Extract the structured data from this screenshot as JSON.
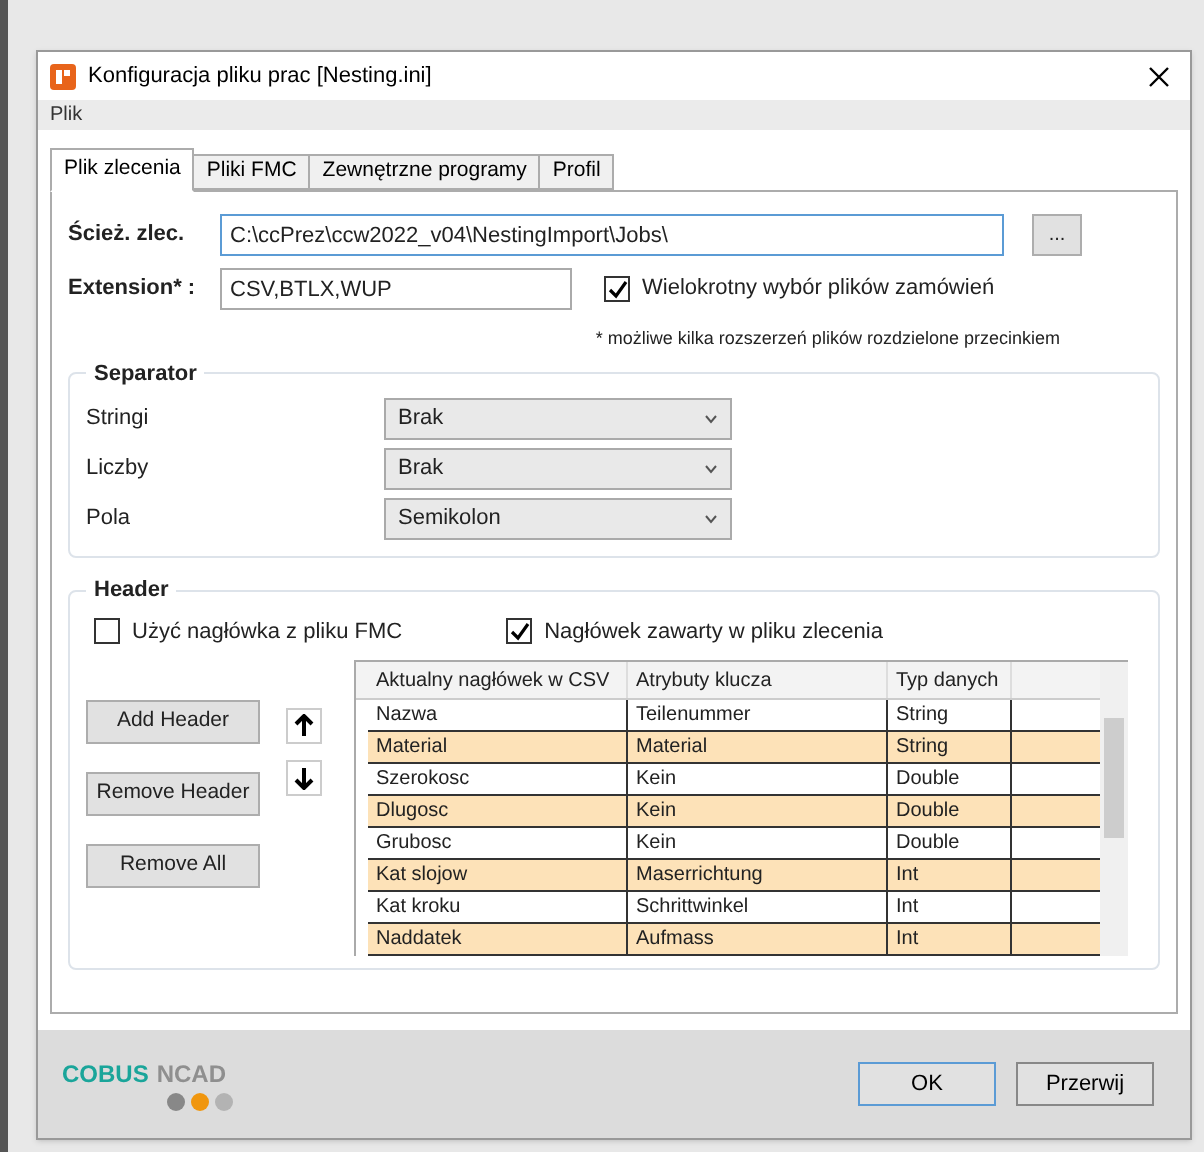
{
  "window": {
    "title": "Konfiguracja pliku prac [Nesting.ini]"
  },
  "menu": [
    "Plik"
  ],
  "tabs": [
    {
      "label": "Plik zlecenia",
      "selected": true
    },
    {
      "label": "Pliki FMC",
      "selected": false
    },
    {
      "label": "Zewnętrzne programy",
      "selected": false
    },
    {
      "label": "Profil",
      "selected": false
    }
  ],
  "path": {
    "label": "Ścież. zlec.",
    "value": "C:\\ccPrez\\ccw2022_v04\\NestingImport\\Jobs\\",
    "browse": "..."
  },
  "extension": {
    "label": "Extension* :",
    "value": "CSV,BTLX,WUP"
  },
  "multi_select": {
    "label": "Wielokrotny wybór plików zamówień",
    "checked": true
  },
  "note": "* możliwe kilka rozszerzeń plików rozdzielone przecinkiem",
  "separator": {
    "title": "Separator",
    "fields": [
      {
        "label": "Stringi",
        "value": "Brak"
      },
      {
        "label": "Liczby",
        "value": "Brak"
      },
      {
        "label": "Pola",
        "value": "Semikolon"
      }
    ]
  },
  "header": {
    "title": "Header",
    "options": [
      {
        "label": "Użyć nagłówka z pliku FMC",
        "checked": false
      },
      {
        "label": "Nagłówek zawarty w pliku zlecenia",
        "checked": true
      }
    ],
    "buttons": [
      "Add Header",
      "Remove Header",
      "Remove All"
    ],
    "table": {
      "columns": [
        "Aktualny nagłówek w CSV",
        "Atrybuty klucza",
        "Typ danych"
      ],
      "rows": [
        [
          "Nazwa",
          "Teilenummer",
          "String"
        ],
        [
          "Material",
          "Material",
          "String"
        ],
        [
          "Szerokosc",
          "Kein",
          "Double"
        ],
        [
          "Dlugosc",
          "Kein",
          "Double"
        ],
        [
          "Grubosc",
          "Kein",
          "Double"
        ],
        [
          "Kat slojow",
          "Maserrichtung",
          "Int"
        ],
        [
          "Kat kroku",
          "Schrittwinkel",
          "Int"
        ],
        [
          "Naddatek",
          "Aufmass",
          "Int"
        ]
      ]
    }
  },
  "footer": {
    "logo": [
      "COBUS",
      "NCAD"
    ],
    "buttons": [
      "OK",
      "Przerwij"
    ]
  }
}
